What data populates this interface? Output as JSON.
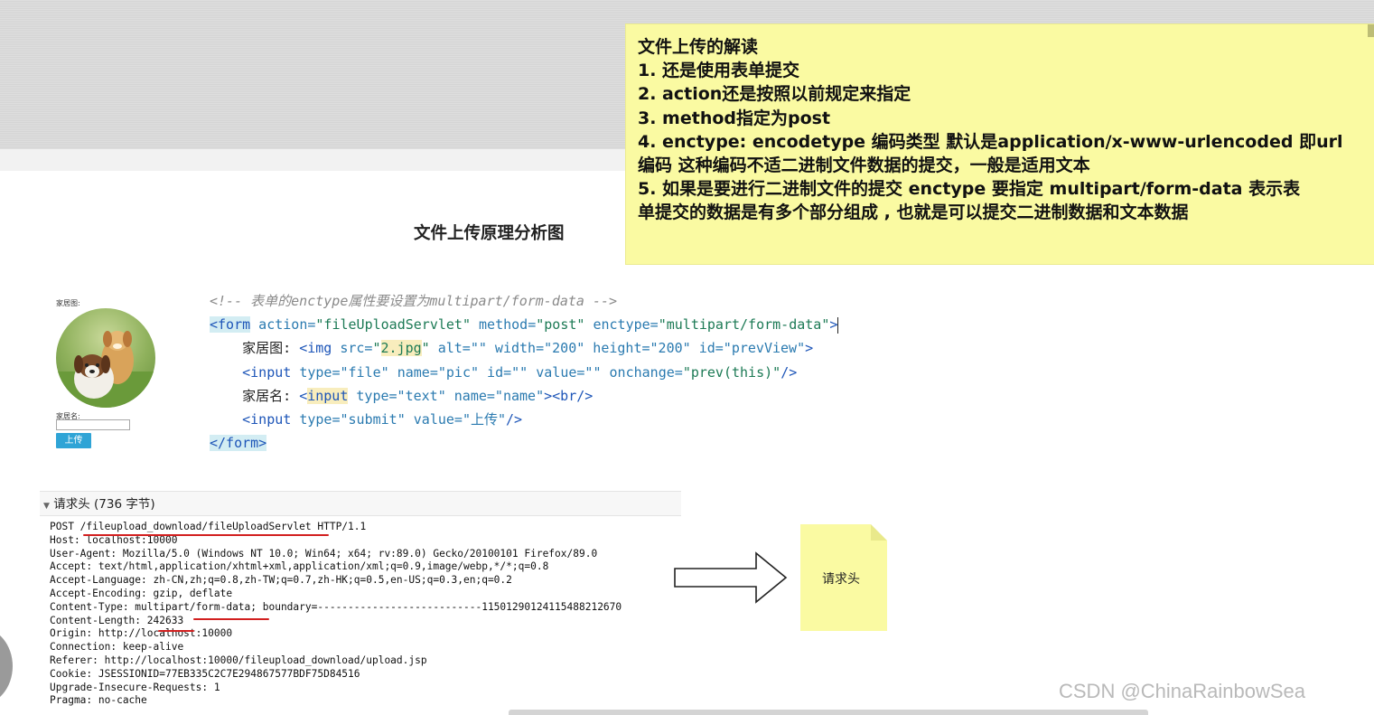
{
  "slide": {
    "title": "文件上传原理分析图",
    "sticky_note": {
      "lines": [
        "文件上传的解读",
        "1. 还是使用表单提交",
        "2. action还是按照以前规定来指定",
        "3. method指定为post",
        "4. enctype: encodetype 编码类型 默认是application/x-www-urlencoded 即url",
        "编码 这种编码不适二进制文件数据的提交，一般是适用文本",
        "5. 如果是要进行二进制文件的提交 enctype 要指定 multipart/form-data  表示表",
        "单提交的数据是有多个部分组成 , 也就是可以提交二进制数据和文本数据"
      ]
    },
    "small_note": {
      "label": "请求头"
    },
    "watermark": "CSDN @ChinaRainbowSea"
  },
  "form_preview": {
    "image_label": "家居图:",
    "name_label": "家居名:",
    "submit_label": "上传",
    "image_subject": "two-puppies-on-grass"
  },
  "code": {
    "comment": "<!-- 表单的enctype属性要设置为multipart/form-data -->",
    "form_open": {
      "tag": "<form",
      "action_attr": " action=",
      "action_val": "\"fileUploadServlet\"",
      "method_attr": " method=",
      "method_val": "\"post\"",
      "enctype_attr": " enctype=",
      "enctype_val": "\"multipart/form-data\"",
      "end": ">"
    },
    "img_line": {
      "prefix": "家居图: ",
      "tag": "<img",
      "src_attr": " src=",
      "src_q1": "\"",
      "src_val": "2.jpg",
      "src_q2": "\"",
      "alt": " alt=\"\"",
      "width": " width=\"200\"",
      "height": " height=\"200\"",
      "id": " id=\"prevView\"",
      "end": ">"
    },
    "file_line": {
      "tag": "<input",
      "type": " type=\"file\"",
      "name": " name=\"pic\"",
      "id": " id=\"\"",
      "value": " value=\"\"",
      "onchange_attr": " onchange=",
      "onchange_val": "\"prev(this)\"",
      "end": "/>"
    },
    "name_line": {
      "prefix": "家居名: ",
      "lt": "<",
      "tag": "input",
      "type": " type=\"text\"",
      "name": " name=\"name\"",
      "end": "><br/>"
    },
    "submit_line": {
      "tag": "<input",
      "type": " type=\"submit\"",
      "value": " value=\"上传\"",
      "end": "/>"
    },
    "form_close": "</form>"
  },
  "request_headers": {
    "title": "请求头 (736 字节)",
    "lines": [
      "POST /fileupload_download/fileUploadServlet HTTP/1.1",
      "Host: localhost:10000",
      "User-Agent: Mozilla/5.0 (Windows NT 10.0; Win64; x64; rv:89.0) Gecko/20100101 Firefox/89.0",
      "Accept: text/html,application/xhtml+xml,application/xml;q=0.9,image/webp,*/*;q=0.8",
      "Accept-Language: zh-CN,zh;q=0.8,zh-TW;q=0.7,zh-HK;q=0.5,en-US;q=0.3,en;q=0.2",
      "Accept-Encoding: gzip, deflate",
      "Content-Type: multipart/form-data; boundary=---------------------------115012901241154882126​70",
      "Content-Length: 242633",
      "Origin: http://localhost:10000",
      "Connection: keep-alive",
      "Referer: http://localhost:10000/fileupload_download/upload.jsp",
      "Cookie: JSESSIONID=77EB335C2C7E294867577BDF75D84516",
      "Upgrade-Insecure-Requests: 1",
      "Pragma: no-cache"
    ]
  },
  "colors": {
    "sticky": "#fafaa2",
    "underline": "#d21f1f",
    "button": "#2fa4d6",
    "tag": "#1d55b8"
  }
}
